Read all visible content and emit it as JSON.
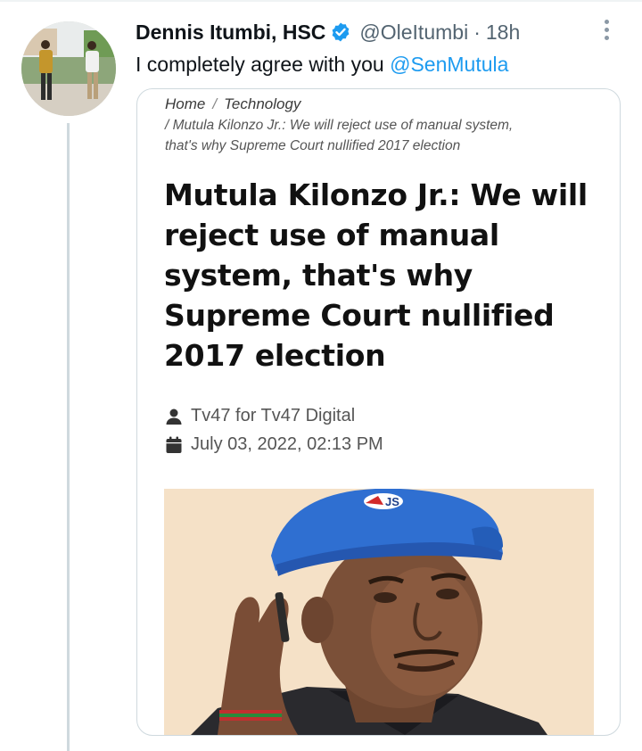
{
  "tweet": {
    "author_name": "Dennis Itumbi, HSC",
    "handle": "@OleItumbi",
    "separator": "·",
    "time": "18h",
    "text_prefix": "I completely agree with you ",
    "mention": "@SenMutula"
  },
  "card": {
    "breadcrumb": {
      "home": "Home",
      "separator": "/",
      "section": "Technology",
      "current_line1": "/ Mutula Kilonzo Jr.: We will reject use of manual system,",
      "current_line2": "that's why Supreme Court nullified 2017 election"
    },
    "headline": "Mutula Kilonzo Jr.: We will reject use of manual system, that's why Supreme Court nullified 2017 election",
    "author": "Tv47 for Tv47 Digital",
    "date": "July 03, 2022, 02:13 PM",
    "cap_logo_text": "JS"
  },
  "colors": {
    "link": "#1d9bf0",
    "verified": "#1d9bf0",
    "thread_line": "#cfd9de",
    "secondary_text": "#536471"
  },
  "icons": [
    "verified-badge-icon",
    "more-options-icon",
    "user-icon",
    "calendar-icon"
  ]
}
